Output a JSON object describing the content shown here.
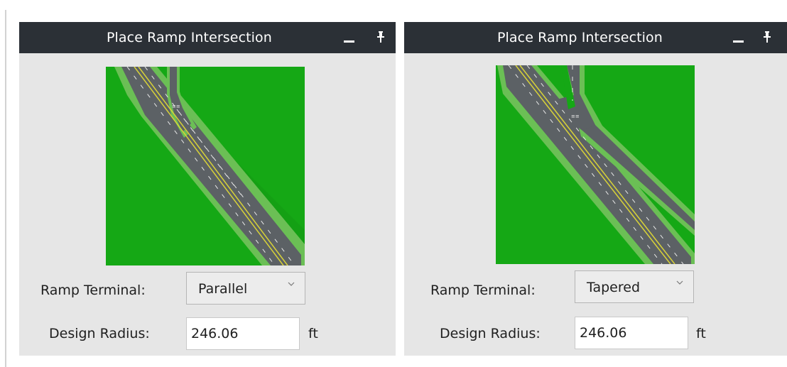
{
  "panels": [
    {
      "title": "Place Ramp Intersection",
      "ramp_terminal_label": "Ramp Terminal:",
      "ramp_terminal_value": "Parallel",
      "design_radius_label": "Design Radius:",
      "design_radius_value": "246.06",
      "design_radius_unit": "ft"
    },
    {
      "title": "Place Ramp Intersection",
      "ramp_terminal_label": "Ramp Terminal:",
      "ramp_terminal_value": "Tapered",
      "design_radius_label": "Design Radius:",
      "design_radius_value": "246.06",
      "design_radius_unit": "ft"
    }
  ],
  "icons": {
    "minimize": "minimize-icon",
    "pin": "pin-icon",
    "dropdown": "chevron-down-icon"
  },
  "colors": {
    "titlebar": "#2b3036",
    "panel_bg": "#e6e6e6",
    "grass": "#15a815",
    "road": "#5c6165",
    "lane_line": "#d8d238"
  }
}
